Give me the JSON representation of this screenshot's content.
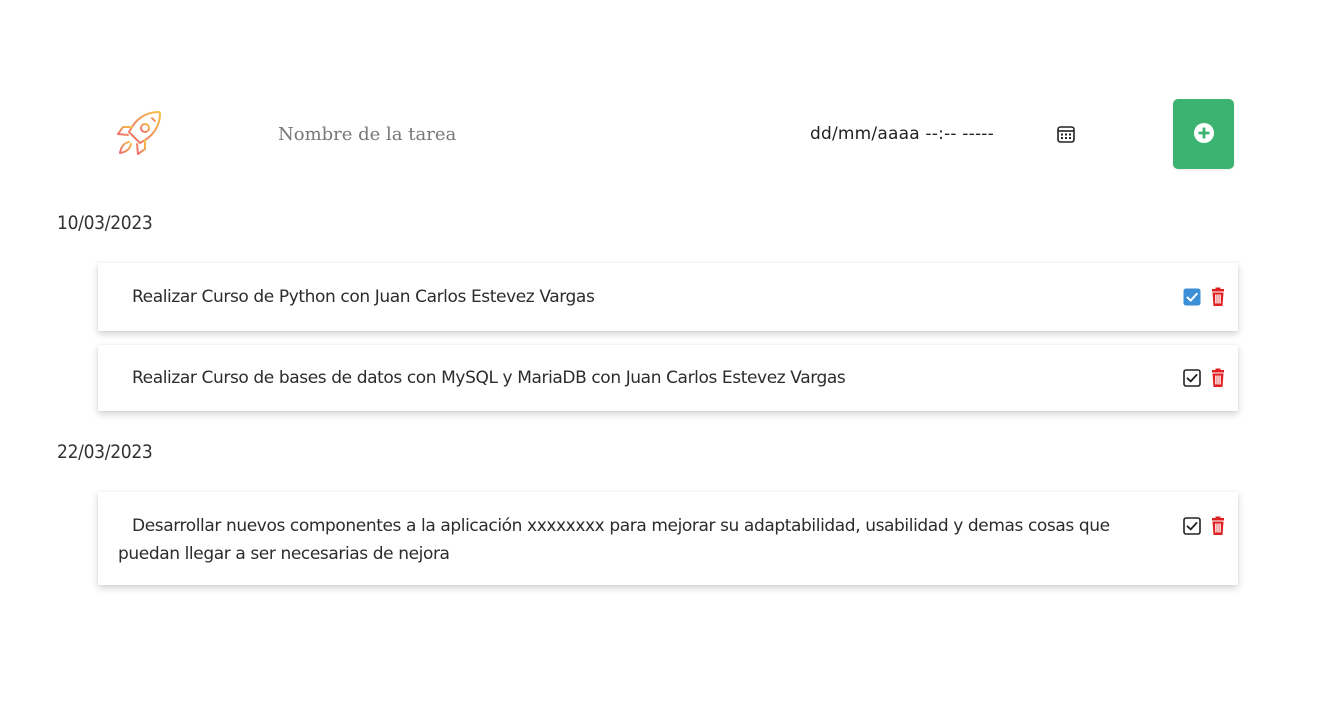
{
  "form": {
    "logo_icon": "rocket-icon",
    "task_placeholder": "Nombre de la tarea",
    "date_placeholder": "dd/mm/aaaa --:-- -----",
    "calendar_icon": "calendar-icon",
    "add_icon": "plus-circle-icon",
    "add_color": "#3cb371"
  },
  "groups": [
    {
      "date": "10/03/2023",
      "tasks": [
        {
          "text": "Realizar Curso de Python con Juan Carlos Estevez Vargas",
          "checked": true
        },
        {
          "text": "Realizar Curso de bases de datos con MySQL y MariaDB con Juan Carlos Estevez Vargas",
          "checked": false
        }
      ]
    },
    {
      "date": "22/03/2023",
      "tasks": [
        {
          "text": "Desarrollar nuevos componentes a la aplicación xxxxxxxx para mejorar su adaptabilidad, usabilidad y demas cosas que puedan llegar a ser necesarias de nejora",
          "checked": false
        }
      ]
    }
  ],
  "colors": {
    "checked": "#3a8fd6",
    "unchecked": "#222222",
    "delete": "#e02020",
    "accent": "#f0a05a"
  }
}
